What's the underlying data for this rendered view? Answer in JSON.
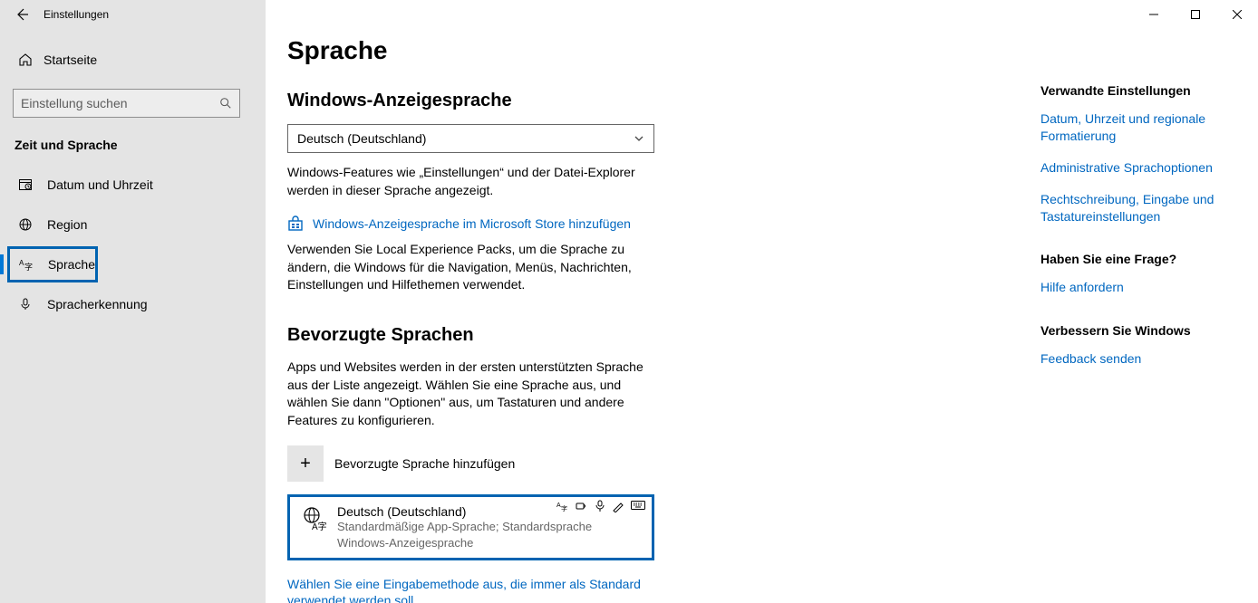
{
  "window": {
    "title": "Einstellungen"
  },
  "sidebar": {
    "home": "Startseite",
    "search_placeholder": "Einstellung suchen",
    "section": "Zeit und Sprache",
    "items": [
      {
        "label": "Datum und Uhrzeit"
      },
      {
        "label": "Region"
      },
      {
        "label": "Sprache"
      },
      {
        "label": "Spracherkennung"
      }
    ]
  },
  "page": {
    "title": "Sprache",
    "display_lang": {
      "heading": "Windows-Anzeigesprache",
      "selected": "Deutsch (Deutschland)",
      "desc": "Windows-Features wie „Einstellungen“ und der Datei-Explorer werden in dieser Sprache angezeigt.",
      "store_link": "Windows-Anzeigesprache im Microsoft Store hinzufügen",
      "store_desc": "Verwenden Sie Local Experience Packs, um die Sprache zu ändern, die Windows für die Navigation, Menüs, Nachrichten, Einstellungen und Hilfethemen verwendet."
    },
    "preferred": {
      "heading": "Bevorzugte Sprachen",
      "desc": "Apps und Websites werden in der ersten unterstützten Sprache aus der Liste angezeigt. Wählen Sie eine Sprache aus, und wählen Sie dann \"Optionen\" aus, um Tastaturen und andere Features zu konfigurieren.",
      "add_label": "Bevorzugte Sprache hinzufügen",
      "item": {
        "name": "Deutsch (Deutschland)",
        "meta": "Standardmäßige App-Sprache; Standardsprache Windows-Anzeigesprache"
      },
      "bottom_link": "Wählen Sie eine Eingabemethode aus, die immer als Standard verwendet werden soll."
    }
  },
  "right": {
    "related_heading": "Verwandte Einstellungen",
    "links": [
      "Datum, Uhrzeit und regionale Formatierung",
      "Administrative Sprachoptionen",
      "Rechtschreibung, Eingabe und Tastatureinstellungen"
    ],
    "help_heading": "Haben Sie eine Frage?",
    "help_link": "Hilfe anfordern",
    "improve_heading": "Verbessern Sie Windows",
    "feedback_link": "Feedback senden"
  }
}
